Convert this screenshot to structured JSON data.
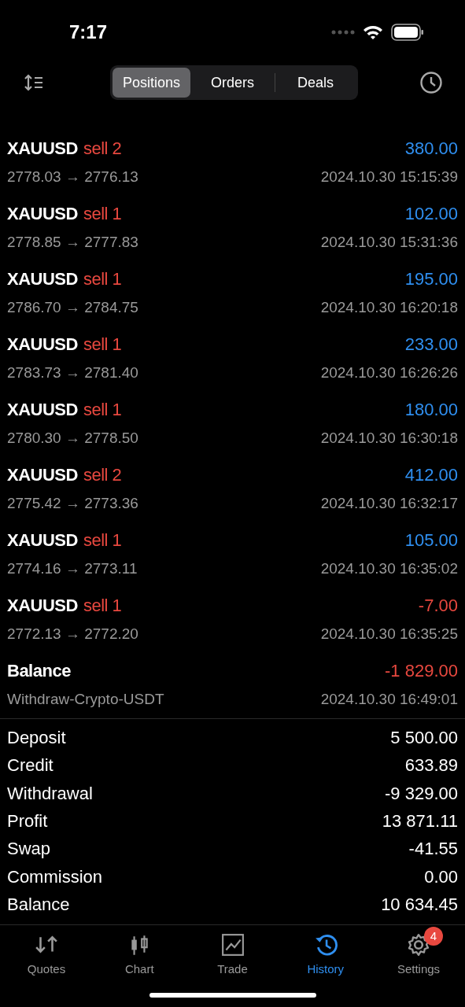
{
  "status_bar": {
    "time": "7:17"
  },
  "segments": [
    {
      "label": "Positions",
      "selected": true
    },
    {
      "label": "Orders",
      "selected": false
    },
    {
      "label": "Deals",
      "selected": false
    }
  ],
  "deals": [
    {
      "symbol": "XAUUSD",
      "type": "sell 2",
      "profit": "380.00",
      "color": "#2f8ff0",
      "prices": "2778.03 → 2776.13",
      "time": "2024.10.30 15:15:39"
    },
    {
      "symbol": "XAUUSD",
      "type": "sell 1",
      "profit": "102.00",
      "color": "#2f8ff0",
      "prices": "2778.85 → 2777.83",
      "time": "2024.10.30 15:31:36"
    },
    {
      "symbol": "XAUUSD",
      "type": "sell 1",
      "profit": "195.00",
      "color": "#2f8ff0",
      "prices": "2786.70 → 2784.75",
      "time": "2024.10.30 16:20:18"
    },
    {
      "symbol": "XAUUSD",
      "type": "sell 1",
      "profit": "233.00",
      "color": "#2f8ff0",
      "prices": "2783.73 → 2781.40",
      "time": "2024.10.30 16:26:26"
    },
    {
      "symbol": "XAUUSD",
      "type": "sell 1",
      "profit": "180.00",
      "color": "#2f8ff0",
      "prices": "2780.30 → 2778.50",
      "time": "2024.10.30 16:30:18"
    },
    {
      "symbol": "XAUUSD",
      "type": "sell 2",
      "profit": "412.00",
      "color": "#2f8ff0",
      "prices": "2775.42 → 2773.36",
      "time": "2024.10.30 16:32:17"
    },
    {
      "symbol": "XAUUSD",
      "type": "sell 1",
      "profit": "105.00",
      "color": "#2f8ff0",
      "prices": "2774.16 → 2773.11",
      "time": "2024.10.30 16:35:02"
    },
    {
      "symbol": "XAUUSD",
      "type": "sell 1",
      "profit": "-7.00",
      "color": "#e8483f",
      "prices": "2772.13 → 2772.20",
      "time": "2024.10.30 16:35:25"
    },
    {
      "symbol": "Balance",
      "profit": "-1 829.00",
      "color": "#e8483f",
      "prices": "Withdraw-Crypto-USDT",
      "time": "2024.10.30 16:49:01"
    }
  ],
  "summary": [
    {
      "label": "Deposit",
      "value": "5 500.00"
    },
    {
      "label": "Credit",
      "value": "633.89"
    },
    {
      "label": "Withdrawal",
      "value": "-9 329.00"
    },
    {
      "label": "Profit",
      "value": "13 871.11"
    },
    {
      "label": "Swap",
      "value": "-41.55"
    },
    {
      "label": "Commission",
      "value": "0.00"
    },
    {
      "label": "Balance",
      "value": "10 634.45"
    }
  ],
  "tab_bar": [
    {
      "kind": "quotes",
      "label": "Quotes",
      "selected": false
    },
    {
      "kind": "chart",
      "label": "Chart",
      "selected": false
    },
    {
      "kind": "trade",
      "label": "Trade",
      "selected": false
    },
    {
      "kind": "history",
      "label": "History",
      "selected": true
    },
    {
      "kind": "settings",
      "label": "Settings",
      "selected": false,
      "badge": "4"
    }
  ]
}
